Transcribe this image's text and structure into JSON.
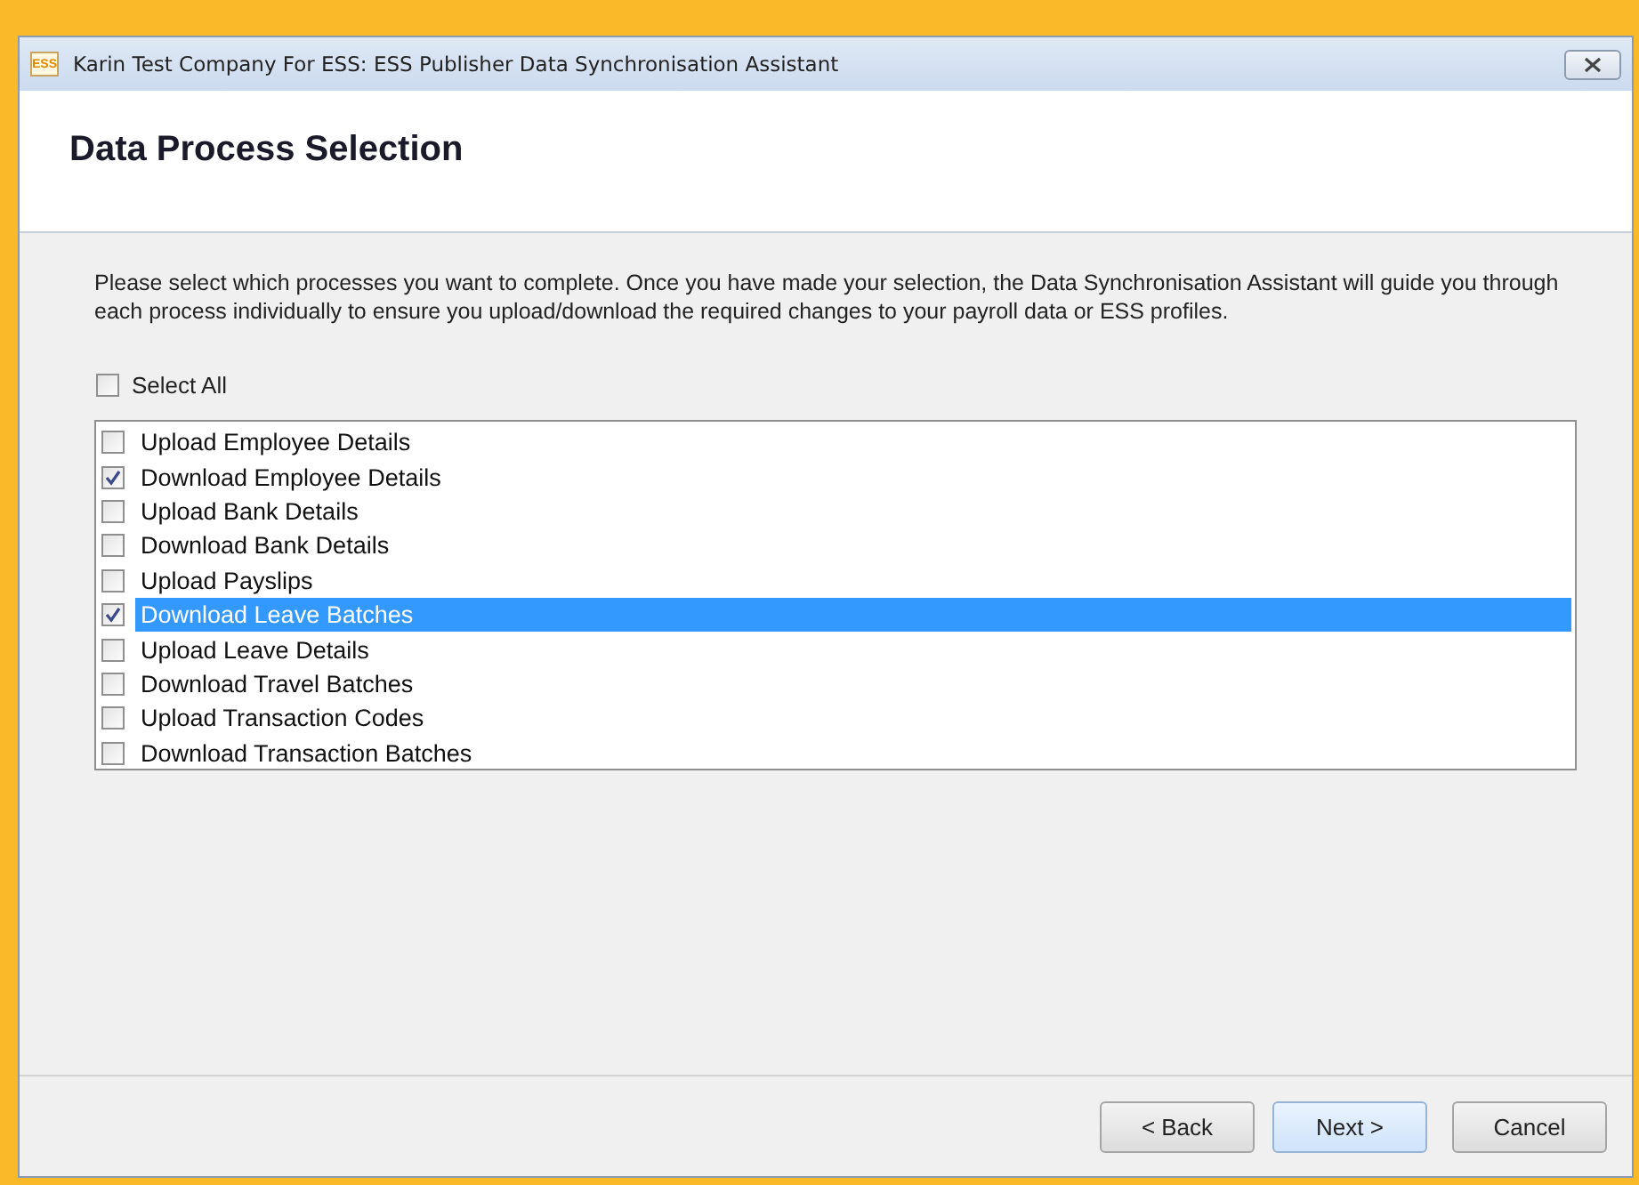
{
  "window": {
    "icon_text": "ESS",
    "title": "Karin Test Company For ESS: ESS Publisher Data Synchronisation Assistant"
  },
  "header": {
    "title": "Data Process Selection"
  },
  "description": "Please select which processes you want to complete. Once you have made your selection, the Data Synchronisation Assistant will guide you through each process individually to ensure you upload/download the required changes to your payroll data or ESS profiles.",
  "select_all": {
    "label": "Select All",
    "checked": false
  },
  "processes": [
    {
      "label": "Upload Employee Details",
      "checked": false,
      "selected": false
    },
    {
      "label": "Download Employee Details",
      "checked": true,
      "selected": false
    },
    {
      "label": "Upload Bank Details",
      "checked": false,
      "selected": false
    },
    {
      "label": "Download Bank Details",
      "checked": false,
      "selected": false
    },
    {
      "label": "Upload Payslips",
      "checked": false,
      "selected": false
    },
    {
      "label": "Download Leave Batches",
      "checked": true,
      "selected": true
    },
    {
      "label": "Upload Leave Details",
      "checked": false,
      "selected": false
    },
    {
      "label": "Download Travel Batches",
      "checked": false,
      "selected": false
    },
    {
      "label": "Upload Transaction Codes",
      "checked": false,
      "selected": false
    },
    {
      "label": "Download Transaction Batches",
      "checked": false,
      "selected": false
    }
  ],
  "buttons": [
    {
      "label": "< Back",
      "default": false
    },
    {
      "label": "Next >",
      "default": true
    },
    {
      "label": "Cancel",
      "default": false
    }
  ]
}
